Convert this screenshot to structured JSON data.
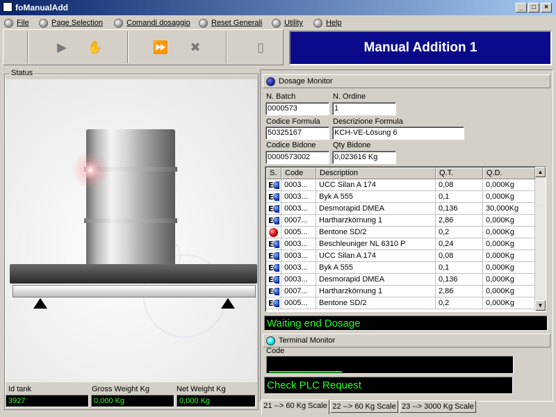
{
  "window": {
    "title": "foManualAdd",
    "controls": [
      "minimize-icon",
      "maximize-icon",
      "close-icon"
    ]
  },
  "menu": [
    {
      "label": "File"
    },
    {
      "label": "Page Selection"
    },
    {
      "label": "Comandi dosaggio"
    },
    {
      "label": "Reset Generali"
    },
    {
      "label": "Utility"
    },
    {
      "label": "Help"
    }
  ],
  "toolbar": {
    "icons": [
      "play-icon",
      "hand-icon",
      "fast-forward-icon",
      "cancel-x-icon",
      "exit-door-icon"
    ]
  },
  "banner": {
    "title": "Manual Addition 1"
  },
  "status": {
    "legend": "Status",
    "id_tank_label": "Id tank",
    "id_tank_value": "3927",
    "gross_label": "Gross Weight Kg",
    "gross_value": "0,000 Kg",
    "net_label": "Net Weight Kg",
    "net_value": "0,000 Kg"
  },
  "dosage": {
    "title": "Dosage Monitor",
    "batch_label": "N. Batch",
    "batch_value": "0000573",
    "order_label": "N. Ordine",
    "order_value": "1",
    "formula_code_label": "Codice Formula",
    "formula_code_value": "50325167",
    "formula_desc_label": "Descrizione Formula",
    "formula_desc_value": "KCH-VE-Lösung 6",
    "drum_code_label": "Codice Bidone",
    "drum_code_value": "0000573002",
    "drum_qty_label": "Qty Bidone",
    "drum_qty_value": "0,023616 Kg",
    "columns": [
      "S.",
      "Code",
      "Description",
      "Q.T.",
      "Q.D."
    ],
    "rows": [
      {
        "icon": "e-blue-icon",
        "code": "0003...",
        "desc": "UCC Silan A 174",
        "qt": "0,08",
        "qd": "0,000Kg"
      },
      {
        "icon": "e-blue-icon",
        "code": "0003...",
        "desc": "Byk A 555",
        "qt": "0,1",
        "qd": "0,000Kg"
      },
      {
        "icon": "e-blue-icon",
        "code": "0003...",
        "desc": "Desmorapid DMEA",
        "qt": "0,136",
        "qd": "30,000Kg"
      },
      {
        "icon": "e-blue-icon",
        "code": "0007...",
        "desc": "Hartharzkörnung 1",
        "qt": "2,86",
        "qd": "0,000Kg"
      },
      {
        "icon": "red-dot-icon",
        "code": "0005...",
        "desc": "Bentone SD/2",
        "qt": "0,2",
        "qd": "0,000Kg"
      },
      {
        "icon": "e-blue-icon",
        "code": "0003...",
        "desc": "Beschleuniger NL 6310 P",
        "qt": "0,24",
        "qd": "0,000Kg"
      },
      {
        "icon": "e-blue-icon",
        "code": "0003...",
        "desc": "UCC Silan A 174",
        "qt": "0,08",
        "qd": "0,000Kg"
      },
      {
        "icon": "e-blue-icon",
        "code": "0003...",
        "desc": "Byk A 555",
        "qt": "0,1",
        "qd": "0,000Kg"
      },
      {
        "icon": "e-blue-icon",
        "code": "0003...",
        "desc": "Desmorapid DMEA",
        "qt": "0,136",
        "qd": "0,000Kg"
      },
      {
        "icon": "e-blue-icon",
        "code": "0007...",
        "desc": "Hartharzkörnung 1",
        "qt": "2,86",
        "qd": "0,000Kg"
      },
      {
        "icon": "e-blue-icon",
        "code": "0005...",
        "desc": "Bentone SD/2",
        "qt": "0,2",
        "qd": "0,000Kg"
      }
    ],
    "status_message": "Waiting end Dosage"
  },
  "terminal": {
    "title": "Terminal Monitor",
    "code_label": "Code",
    "code_value": "",
    "progress": 0.3,
    "message": "Check PLC Request"
  },
  "tabs": [
    {
      "label": "21 --> 60 Kg Scale",
      "active": true
    },
    {
      "label": "22 --> 60 Kg Scale",
      "active": false
    },
    {
      "label": "23 --> 3000 Kg Scale",
      "active": false
    }
  ],
  "colors": {
    "banner_bg": "#0a0a8a",
    "led_dosage": "#1a2a9a",
    "led_terminal": "#00e5e5",
    "lcd_text": "#21ff21"
  }
}
